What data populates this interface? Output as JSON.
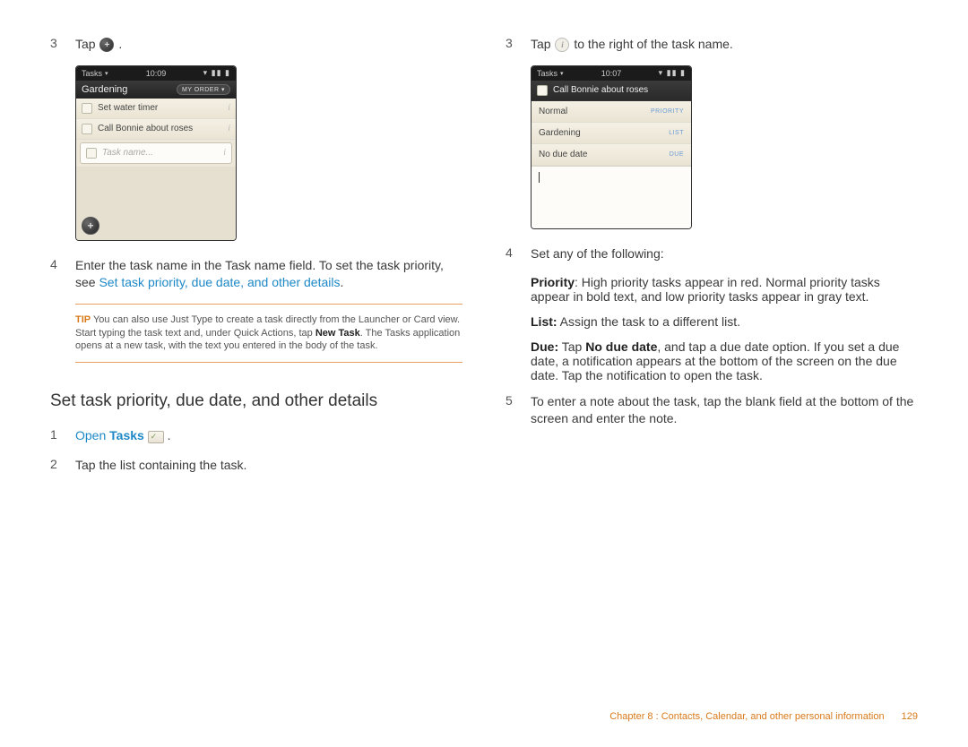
{
  "left": {
    "step3": {
      "num": "3",
      "text": "Tap",
      "period": "."
    },
    "phone1": {
      "status_app": "Tasks",
      "status_time": "10:09",
      "status_right": "▾ ▮▮ ▮",
      "header_title": "Gardening",
      "header_button": "MY ORDER ▾",
      "row1": "Set water timer",
      "row2": "Call Bonnie about roses",
      "input_placeholder": "Task name..."
    },
    "step4": {
      "num": "4",
      "text": "Enter the task name in the Task name field. To set the task priority, see ",
      "link": "Set task priority, due date, and other details",
      "period": "."
    },
    "tip": {
      "label": "TIP",
      "text_a": "  You can also use Just Type to create a task directly from the Launcher or Card view. Start typing the task text and, under Quick Actions, tap ",
      "bold": "New Task",
      "text_b": ". The Tasks application opens at a new task, with the text you entered in the body of the task."
    },
    "heading": "Set task priority, due date, and other details",
    "step1": {
      "num": "1",
      "link_a": "Open",
      "link_b": "Tasks",
      "period": "."
    },
    "step2": {
      "num": "2",
      "text": "Tap the list containing the task."
    }
  },
  "right": {
    "step3": {
      "num": "3",
      "text_a": "Tap ",
      "text_b": " to the right of the task name."
    },
    "phone2": {
      "status_app": "Tasks",
      "status_time": "10:07",
      "status_right": "▾ ▮▮ ▮",
      "title_row": "Call Bonnie about roses",
      "r1_val": "Normal",
      "r1_lbl": "PRIORITY",
      "r2_val": "Gardening",
      "r2_lbl": "LIST",
      "r3_val": "No due date",
      "r3_lbl": "DUE"
    },
    "step4": {
      "num": "4",
      "text": "Set any of the following:"
    },
    "p_priority_b": "Priority",
    "p_priority": ": High priority tasks appear in red. Normal priority tasks appear in bold text, and low priority tasks appear in gray text.",
    "p_list_b": "List:",
    "p_list": " Assign the task to a different list.",
    "p_due_b": "Due:",
    "p_due_a": " Tap ",
    "p_due_b2": "No due date",
    "p_due_c": ", and tap a due date option. If you set a due date, a notification appears at the bottom of the screen on the due date. Tap the notification to open the task.",
    "step5": {
      "num": "5",
      "text": "To enter a note about the task, tap the blank field at the bottom of the screen and enter the note."
    }
  },
  "footer": {
    "chapter": "Chapter 8 : Contacts, Calendar, and other personal information",
    "page": "129"
  }
}
